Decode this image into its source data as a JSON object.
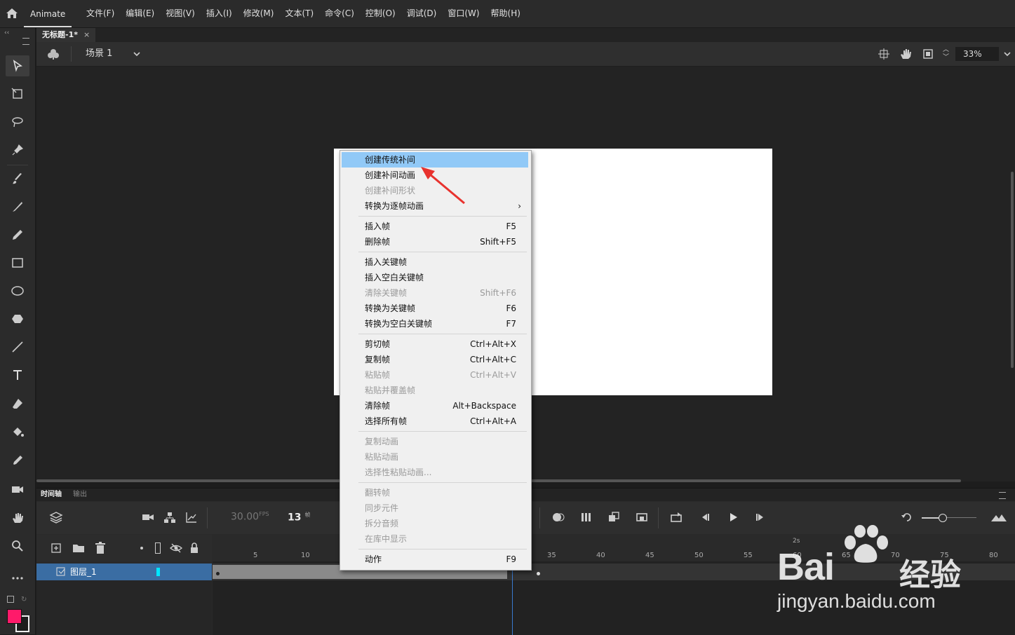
{
  "app": {
    "name": "Animate",
    "menu": [
      "文件(F)",
      "编辑(E)",
      "视图(V)",
      "插入(I)",
      "修改(M)",
      "文本(T)",
      "命令(C)",
      "控制(O)",
      "调试(D)",
      "窗口(W)",
      "帮助(H)"
    ]
  },
  "document": {
    "tab_title": "无标题-1*",
    "close": "×"
  },
  "scene": {
    "label": "场景 1",
    "zoom": "33%"
  },
  "timeline": {
    "tab_timeline": "时间轴",
    "tab_output": "输出",
    "fps": "30.00",
    "fps_unit": "FPS",
    "current_frame": "13",
    "frame_unit": "帧",
    "layer_name": "图层_1",
    "ruler_labels": [
      "5",
      "10",
      "35",
      "40",
      "45",
      "50",
      "55",
      "60",
      "65",
      "70",
      "75",
      "80"
    ],
    "ruler_seconds": "2s"
  },
  "context_menu": {
    "items": [
      {
        "label": "创建传统补间",
        "shortcut": "",
        "state": "highlighted"
      },
      {
        "label": "创建补间动画",
        "shortcut": "",
        "state": "enabled"
      },
      {
        "label": "创建补间形状",
        "shortcut": "",
        "state": "disabled"
      },
      {
        "label": "转换为逐帧动画",
        "shortcut": "›",
        "state": "enabled"
      },
      {
        "label": "插入帧",
        "shortcut": "F5",
        "state": "enabled"
      },
      {
        "label": "删除帧",
        "shortcut": "Shift+F5",
        "state": "enabled"
      },
      {
        "label": "插入关键帧",
        "shortcut": "",
        "state": "enabled"
      },
      {
        "label": "插入空白关键帧",
        "shortcut": "",
        "state": "enabled"
      },
      {
        "label": "清除关键帧",
        "shortcut": "Shift+F6",
        "state": "disabled"
      },
      {
        "label": "转换为关键帧",
        "shortcut": "F6",
        "state": "enabled"
      },
      {
        "label": "转换为空白关键帧",
        "shortcut": "F7",
        "state": "enabled"
      },
      {
        "label": "剪切帧",
        "shortcut": "Ctrl+Alt+X",
        "state": "enabled"
      },
      {
        "label": "复制帧",
        "shortcut": "Ctrl+Alt+C",
        "state": "enabled"
      },
      {
        "label": "粘贴帧",
        "shortcut": "Ctrl+Alt+V",
        "state": "disabled"
      },
      {
        "label": "粘贴并覆盖帧",
        "shortcut": "",
        "state": "disabled"
      },
      {
        "label": "清除帧",
        "shortcut": "Alt+Backspace",
        "state": "enabled"
      },
      {
        "label": "选择所有帧",
        "shortcut": "Ctrl+Alt+A",
        "state": "enabled"
      },
      {
        "label": "复制动画",
        "shortcut": "",
        "state": "disabled"
      },
      {
        "label": "粘贴动画",
        "shortcut": "",
        "state": "disabled"
      },
      {
        "label": "选择性粘贴动画...",
        "shortcut": "",
        "state": "disabled"
      },
      {
        "label": "翻转帧",
        "shortcut": "",
        "state": "disabled"
      },
      {
        "label": "同步元件",
        "shortcut": "",
        "state": "disabled"
      },
      {
        "label": "拆分音频",
        "shortcut": "",
        "state": "disabled"
      },
      {
        "label": "在库中显示",
        "shortcut": "",
        "state": "disabled"
      },
      {
        "label": "动作",
        "shortcut": "F9",
        "state": "enabled"
      }
    ]
  },
  "colors": {
    "stroke": "#ff1a6a",
    "highlight": "#91c9f7",
    "layer_selected": "#3a6da3",
    "playhead": "#3a7ad0"
  },
  "watermark": {
    "brand": "Bai",
    "brand_cn": "经验",
    "sub": "jingyan.baidu.com"
  }
}
